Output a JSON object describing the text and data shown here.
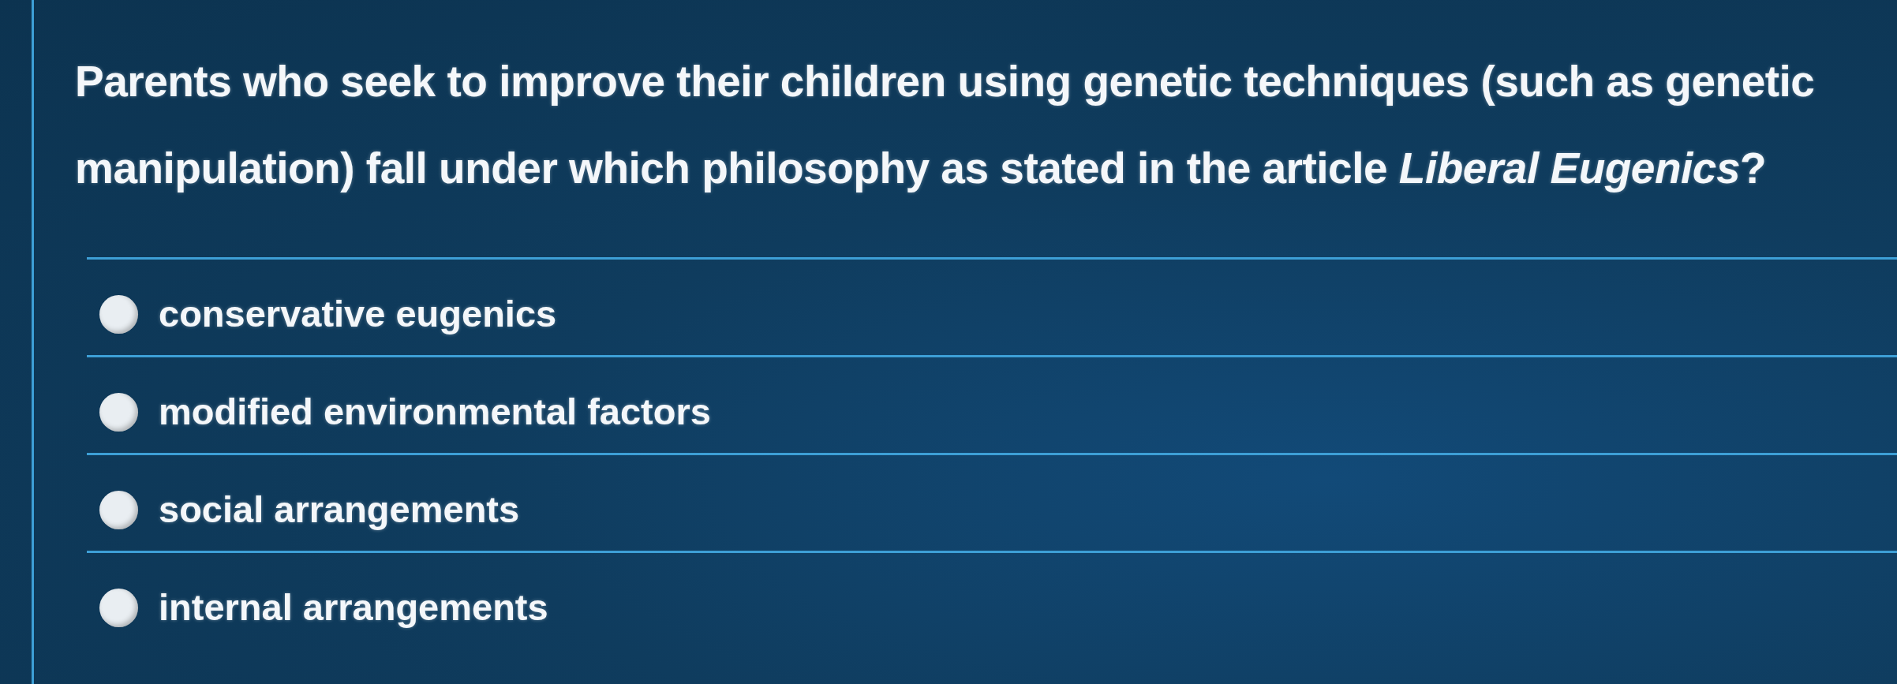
{
  "question": {
    "text": "Parents who seek to improve their children using genetic techniques (such as genetic manipulation) fall under which philosophy as stated in the article *Liberal Eugenics*?"
  },
  "options": [
    {
      "label": "conservative eugenics",
      "selected": false
    },
    {
      "label": "modified environmental factors",
      "selected": false
    },
    {
      "label": "social arrangements",
      "selected": false
    },
    {
      "label": "internal arrangements",
      "selected": false
    }
  ]
}
